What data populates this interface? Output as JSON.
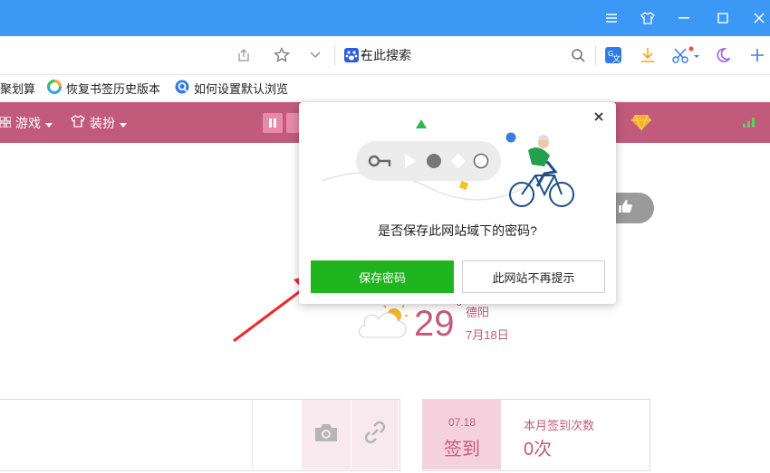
{
  "addressbar": {
    "search_placeholder": "在此搜索"
  },
  "bookmarks": [
    {
      "label": "聚划算"
    },
    {
      "label": "恢复书签历史版本"
    },
    {
      "label": "如何设置默认浏览"
    }
  ],
  "nav": {
    "game": "游戏",
    "dress": "装扮"
  },
  "popup": {
    "question": "是否保存此网站域下的密码?",
    "save": "保存密码",
    "no_more": "此网站不再提示"
  },
  "weather": {
    "temp": "29",
    "deg": "°",
    "city": "德阳",
    "date": "7月18日"
  },
  "signin": {
    "date": "07.18",
    "label": "签到",
    "month_label": "本月签到次数",
    "count": "0次"
  },
  "colors": {
    "titlebar": "#3b98f5",
    "nav": "#c25a7c",
    "save": "#1fb51f",
    "arrow": "#f02a2a"
  }
}
